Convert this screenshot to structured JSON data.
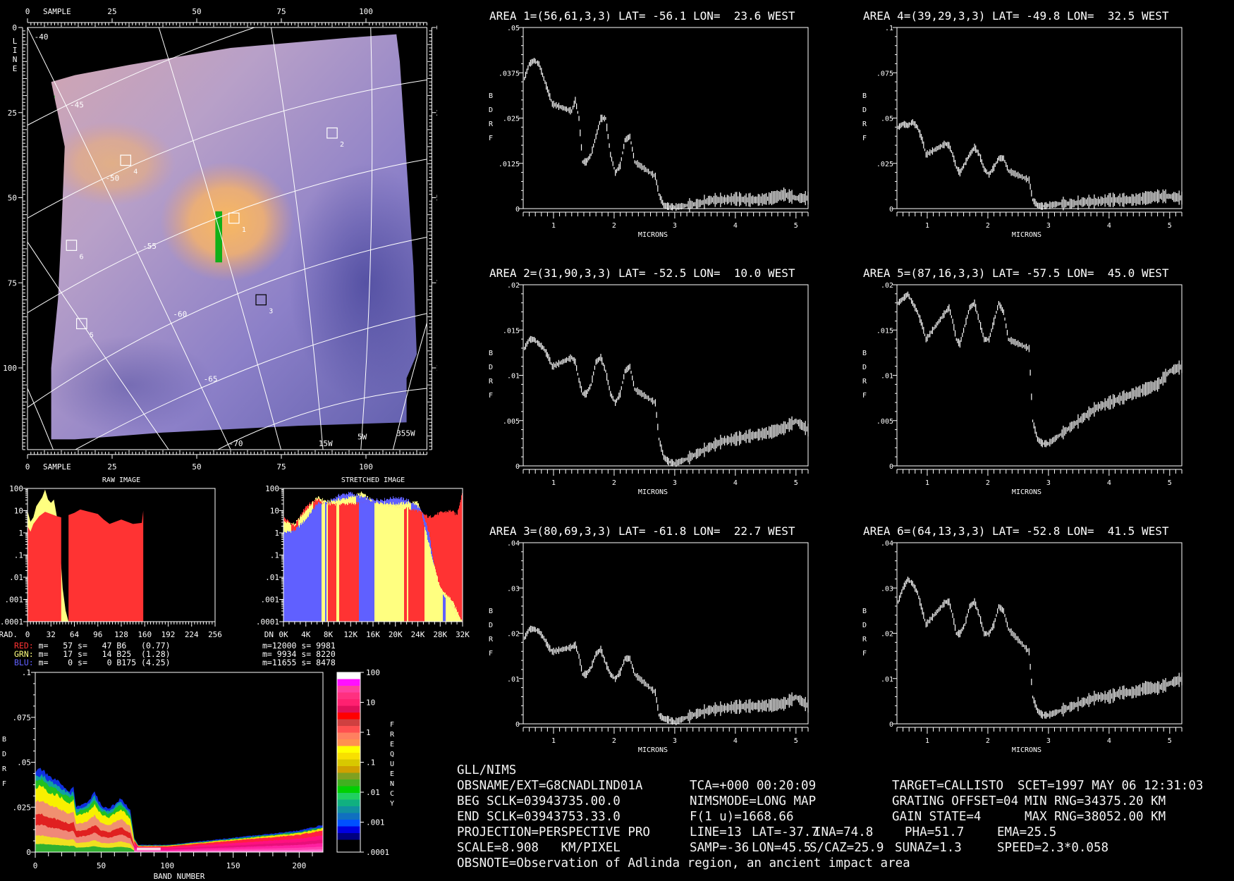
{
  "map": {
    "sample_label": "SAMPLE",
    "line_letters": [
      "L",
      "I",
      "N",
      "E"
    ],
    "axis_ticks": [
      "0",
      "25",
      "50",
      "75",
      "100"
    ],
    "lat_labels": [
      "-40",
      "-45",
      "-50",
      "-55",
      "-60",
      "-65",
      "-70"
    ],
    "lon_labels": [
      "15W",
      "5W",
      "355W"
    ]
  },
  "areas": [
    {
      "label": "1",
      "line": 56,
      "sample": 61,
      "title": "AREA 1=(56,61,3,3) LAT= -56.1 LON=  23.6 WEST",
      "ymax": 0.05,
      "yticks": [
        "0",
        ".0125",
        ".025",
        ".0375",
        ".05"
      ],
      "box_color": "#ffffff",
      "y": [
        0.036,
        0.04,
        0.041,
        0.04,
        0.036,
        0.032,
        0.029,
        0.027,
        0.03,
        0.025,
        0.013,
        0.013,
        0.015,
        0.02,
        0.025,
        0.025,
        0.015,
        0.01,
        0.012,
        0.019,
        0.02,
        0.013,
        0.009,
        0.004,
        0.001,
        0.0007,
        0.0005,
        0.001,
        0.0015,
        0.0025,
        0.0025,
        0.0028,
        0.0025,
        0.0025,
        0.003,
        0.004,
        0.003,
        0.003
      ]
    },
    {
      "label": "2",
      "line": 31,
      "sample": 90,
      "title": "AREA 2=(31,90,3,3) LAT= -52.5 LON=  10.0 WEST",
      "ymax": 0.02,
      "yticks": [
        "0",
        ".005",
        ".01",
        ".015",
        ".02"
      ],
      "box_color": "#ffffff",
      "y": [
        0.013,
        0.014,
        0.014,
        0.0135,
        0.013,
        0.012,
        0.011,
        0.012,
        0.0115,
        0.0095,
        0.008,
        0.008,
        0.009,
        0.0115,
        0.012,
        0.0105,
        0.008,
        0.007,
        0.008,
        0.0105,
        0.011,
        0.0085,
        0.007,
        0.003,
        0.001,
        0.0005,
        0.0003,
        0.0008,
        0.0015,
        0.0022,
        0.0028,
        0.003,
        0.0033,
        0.0035,
        0.0038,
        0.0042,
        0.005,
        0.004
      ]
    },
    {
      "label": "3",
      "line": 80,
      "sample": 69,
      "title": "AREA 3=(80,69,3,3) LAT= -61.8 LON=  22.7 WEST",
      "ymax": 0.04,
      "yticks": [
        "0",
        ".01",
        ".02",
        ".03",
        ".04"
      ],
      "box_color": "#000000",
      "y": [
        0.019,
        0.021,
        0.021,
        0.0205,
        0.019,
        0.017,
        0.016,
        0.017,
        0.0175,
        0.015,
        0.011,
        0.011,
        0.0125,
        0.0155,
        0.0165,
        0.0135,
        0.011,
        0.01,
        0.0115,
        0.0145,
        0.0145,
        0.011,
        0.007,
        0.002,
        0.0012,
        0.001,
        0.0005,
        0.0015,
        0.0025,
        0.0032,
        0.0035,
        0.0038,
        0.004,
        0.004,
        0.0042,
        0.0045,
        0.006,
        0.004
      ]
    },
    {
      "label": "4",
      "line": 39,
      "sample": 29,
      "title": "AREA 4=(39,29,3,3) LAT= -49.8 LON=  32.5 WEST",
      "ymax": 0.1,
      "yticks": [
        "0",
        ".025",
        ".05",
        ".075",
        ".1"
      ],
      "box_color": "#ffffff",
      "y": [
        0.045,
        0.047,
        0.046,
        0.048,
        0.045,
        0.038,
        0.03,
        0.036,
        0.035,
        0.03,
        0.023,
        0.02,
        0.025,
        0.03,
        0.034,
        0.03,
        0.022,
        0.019,
        0.023,
        0.028,
        0.028,
        0.021,
        0.016,
        0.005,
        0.002,
        0.0015,
        0.002,
        0.003,
        0.003,
        0.004,
        0.004,
        0.005,
        0.005,
        0.005,
        0.006,
        0.007,
        0.007,
        0.006
      ]
    },
    {
      "label": "5",
      "line": 87,
      "sample": 16,
      "title": "AREA 5=(87,16,3,3) LAT= -57.5 LON=  45.0 WEST",
      "ymax": 0.02,
      "yticks": [
        "0",
        ".005",
        ".01",
        ".015",
        ".02"
      ],
      "box_color": "#ffffff",
      "y": [
        0.018,
        0.0185,
        0.019,
        0.018,
        0.017,
        0.0155,
        0.014,
        0.017,
        0.0175,
        0.016,
        0.014,
        0.0135,
        0.0155,
        0.0175,
        0.018,
        0.016,
        0.014,
        0.014,
        0.016,
        0.018,
        0.017,
        0.014,
        0.013,
        0.005,
        0.003,
        0.0025,
        0.0025,
        0.0035,
        0.0045,
        0.0055,
        0.0065,
        0.007,
        0.0075,
        0.008,
        0.0085,
        0.009,
        0.0105,
        0.011
      ]
    },
    {
      "label": "6",
      "line": 64,
      "sample": 13,
      "title": "AREA 6=(64,13,3,3) LAT= -52.8 LON=  41.5 WEST",
      "ymax": 0.04,
      "yticks": [
        "0",
        ".01",
        ".02",
        ".03",
        ".04"
      ],
      "box_color": "#ffffff",
      "y": [
        0.027,
        0.03,
        0.032,
        0.031,
        0.029,
        0.025,
        0.022,
        0.027,
        0.027,
        0.024,
        0.02,
        0.02,
        0.022,
        0.026,
        0.027,
        0.024,
        0.02,
        0.02,
        0.022,
        0.026,
        0.025,
        0.021,
        0.016,
        0.006,
        0.003,
        0.002,
        0.002,
        0.003,
        0.004,
        0.005,
        0.006,
        0.006,
        0.007,
        0.007,
        0.008,
        0.008,
        0.009,
        0.01
      ]
    }
  ],
  "chart_data": [
    {
      "type": "scatter",
      "title": "Area spectra",
      "xlabel": "MICRONS",
      "ylabel": "BDRF",
      "ylabel_letters": [
        "B",
        "D",
        "R",
        "F"
      ],
      "xlim": [
        0.5,
        5.2
      ],
      "xticks": [
        "1",
        "2",
        "3",
        "4",
        "5"
      ],
      "x": [
        0.52,
        0.6,
        0.68,
        0.76,
        0.84,
        0.92,
        0.98,
        1.3,
        1.36,
        1.42,
        1.48,
        1.54,
        1.62,
        1.7,
        1.78,
        1.86,
        1.94,
        2.02,
        2.1,
        2.18,
        2.26,
        2.34,
        2.68,
        2.74,
        2.82,
        2.9,
        3.0,
        3.2,
        3.4,
        3.6,
        3.8,
        4.0,
        4.2,
        4.4,
        4.6,
        4.8,
        5.0,
        5.2
      ]
    },
    {
      "type": "area",
      "title": "RAW IMAGE",
      "xlabel": "RAD.",
      "xlim": [
        0,
        256
      ],
      "ylim_log10": [
        -4,
        2
      ],
      "xticks": [
        "0",
        "32",
        "64",
        "96",
        "128",
        "160",
        "192",
        "224",
        "256"
      ],
      "yticks": [
        "100",
        "10",
        "1",
        ".1",
        ".01",
        ".001",
        ".0001"
      ],
      "series": [
        {
          "name": "GRN",
          "color": "#ffff80",
          "points": [
            [
              0,
              1.0
            ],
            [
              4,
              0.5
            ],
            [
              8,
              0.7
            ],
            [
              12,
              1.2
            ],
            [
              16,
              1.4
            ],
            [
              20,
              1.6
            ],
            [
              24,
              1.95
            ],
            [
              28,
              1.5
            ],
            [
              32,
              1.35
            ],
            [
              36,
              1.5
            ],
            [
              40,
              0.75
            ],
            [
              44,
              -0.5
            ],
            [
              48,
              -2.5
            ],
            [
              52,
              -3.5
            ],
            [
              56,
              -4
            ]
          ]
        },
        {
          "name": "RED",
          "color": "#ff3333",
          "points": [
            [
              0,
              0.3
            ],
            [
              4,
              0.05
            ],
            [
              8,
              0.4
            ],
            [
              16,
              0.75
            ],
            [
              24,
              0.95
            ],
            [
              32,
              0.85
            ],
            [
              40,
              0.75
            ],
            [
              46,
              0.7
            ],
            [
              56,
              0.8
            ],
            [
              64,
              0.9
            ],
            [
              72,
              1.05
            ],
            [
              84,
              0.95
            ],
            [
              96,
              0.85
            ],
            [
              104,
              0.6
            ],
            [
              112,
              0.4
            ],
            [
              120,
              0.5
            ],
            [
              128,
              0.6
            ],
            [
              136,
              0.5
            ],
            [
              144,
              0.4
            ],
            [
              156,
              0.45
            ],
            [
              158,
              1.0
            ]
          ]
        }
      ],
      "legend": [
        {
          "name": "RED:",
          "color": "#ff3333",
          "text": "m=   57 s=   47 B6   (0.77)"
        },
        {
          "name": "GRN:",
          "color": "#ffff80",
          "text": "m=   17 s=   14 B25  (1.28)"
        },
        {
          "name": "BLU:",
          "color": "#6060ff",
          "text": "m=    0 s=    0 B175 (4.25)"
        }
      ]
    },
    {
      "type": "area",
      "title": "STRETCHED IMAGE",
      "xlabel": "DN",
      "xlim": [
        0,
        32
      ],
      "ylim_log10": [
        -4,
        2
      ],
      "xticks": [
        "0K",
        "4K",
        "8K",
        "12K",
        "16K",
        "20K",
        "24K",
        "28K",
        "32K"
      ],
      "yticks": [
        "100",
        "10",
        "1",
        ".1",
        ".01",
        ".001",
        ".0001"
      ],
      "series": [
        {
          "name": "BLU",
          "color": "#6060ff",
          "points": [
            [
              0,
              0
            ],
            [
              2,
              0.1
            ],
            [
              4,
              0.6
            ],
            [
              6,
              1.3
            ],
            [
              8,
              1.4
            ],
            [
              10,
              1.7
            ],
            [
              12,
              1.8
            ],
            [
              14,
              1.6
            ],
            [
              16,
              1.5
            ],
            [
              18,
              1.5
            ],
            [
              20,
              1.6
            ],
            [
              22,
              1.5
            ],
            [
              24,
              1.2
            ],
            [
              25,
              0.8
            ],
            [
              26,
              0
            ],
            [
              27,
              -1.5
            ],
            [
              28,
              -2.5
            ],
            [
              29,
              -3
            ],
            [
              30,
              -3.2
            ],
            [
              31,
              -3.8
            ],
            [
              32,
              -4
            ]
          ]
        },
        {
          "name": "RED",
          "color": "#ff3333",
          "points": [
            [
              0,
              0.7
            ],
            [
              2,
              0.3
            ],
            [
              4,
              1.2
            ],
            [
              6,
              1.5
            ],
            [
              8,
              1.3
            ],
            [
              12,
              1.3
            ],
            [
              16,
              1.4
            ],
            [
              20,
              1.2
            ],
            [
              24,
              1.0
            ],
            [
              26,
              0.7
            ],
            [
              28,
              0.9
            ],
            [
              30,
              1.0
            ],
            [
              31,
              0.8
            ],
            [
              32,
              1.9
            ]
          ]
        },
        {
          "name": "GRN",
          "color": "#ffff80",
          "points": [
            [
              0,
              0.5
            ],
            [
              2,
              0.4
            ],
            [
              4,
              1.0
            ],
            [
              6,
              1.6
            ],
            [
              8,
              1.4
            ],
            [
              12,
              1.6
            ],
            [
              14,
              1.8
            ],
            [
              16,
              1.4
            ],
            [
              20,
              1.3
            ],
            [
              24,
              1.4
            ],
            [
              25,
              0.5
            ],
            [
              26,
              -0.5
            ],
            [
              28,
              -2.5
            ],
            [
              30,
              -3
            ],
            [
              31,
              -3.5
            ],
            [
              32,
              -4
            ]
          ]
        }
      ],
      "bands": [
        [
          0,
          6.8,
          "BLU"
        ],
        [
          6.8,
          7.4,
          "GRN"
        ],
        [
          7.4,
          7.7,
          "BLU"
        ],
        [
          7.7,
          8.0,
          "GRN"
        ],
        [
          8.0,
          9.5,
          "RED"
        ],
        [
          9.5,
          10.0,
          "GRN"
        ],
        [
          10.0,
          13.5,
          "RED"
        ],
        [
          13.5,
          16.2,
          "BLU"
        ],
        [
          16.2,
          21.5,
          "GRN"
        ],
        [
          21.5,
          22.0,
          "RED"
        ],
        [
          22.0,
          22.3,
          "GRN"
        ],
        [
          22.3,
          25.2,
          "RED"
        ],
        [
          25.2,
          28.5,
          "GRN"
        ],
        [
          28.5,
          29.0,
          "BLU"
        ],
        [
          29.0,
          32,
          "GRN"
        ]
      ],
      "legend": [
        "m=12000 s= 9981",
        "m= 9934 s= 8220",
        "m=11655 s= 8478"
      ]
    },
    {
      "type": "heatmap",
      "title": "BDRF density",
      "xlabel": "BAND NUMBER",
      "ylabel_letters": [
        "B",
        "D",
        "R",
        "F"
      ],
      "xlim": [
        0,
        218
      ],
      "ylim": [
        0,
        0.1
      ],
      "xticks": [
        "0",
        "50",
        "100",
        "150",
        "200"
      ],
      "yticks": [
        "0",
        ".025",
        ".05",
        ".075",
        ".1"
      ],
      "envelope": [
        [
          0,
          0.045
        ],
        [
          5,
          0.046
        ],
        [
          10,
          0.042
        ],
        [
          18,
          0.039
        ],
        [
          26,
          0.034
        ],
        [
          29,
          0.036
        ],
        [
          31,
          0.025
        ],
        [
          40,
          0.028
        ],
        [
          45,
          0.033
        ],
        [
          50,
          0.026
        ],
        [
          56,
          0.024
        ],
        [
          65,
          0.03
        ],
        [
          72,
          0.023
        ],
        [
          75,
          0.008
        ],
        [
          78,
          0.004
        ],
        [
          100,
          0.004
        ],
        [
          150,
          0.008
        ],
        [
          175,
          0.01
        ],
        [
          200,
          0.012
        ],
        [
          218,
          0.015
        ]
      ],
      "colorbar": {
        "label_letters": [
          "F",
          "R",
          "E",
          "Q",
          "U",
          "E",
          "N",
          "C",
          "Y"
        ],
        "ticks": [
          "100",
          "10",
          "1",
          ".1",
          ".01",
          ".001",
          ".0001"
        ],
        "colors": [
          "#ffffff",
          "#ff10ff",
          "#ff40a0",
          "#ff3080",
          "#ff2070",
          "#e0105a",
          "#ff0000",
          "#d04040",
          "#ff5050",
          "#ff8060",
          "#ff9050",
          "#ffff00",
          "#f8e000",
          "#d8c800",
          "#d0a000",
          "#80a020",
          "#40b020",
          "#00d000",
          "#20d060",
          "#10b080",
          "#1090a0",
          "#1070c0",
          "#0050ff",
          "#0000e0",
          "#000080",
          "#000000"
        ]
      }
    }
  ],
  "info": {
    "header": "GLL/NIMS",
    "rows": [
      [
        "OBSNAME/EXT=G8CNADLIND01A",
        "TCA=+000 00:20:09",
        "TARGET=CALLISTO",
        "SCET=1997 MAY 06 12:31:03"
      ],
      [
        "BEG SCLK=03943735.00.0",
        "NIMSMODE=LONG MAP",
        "GRATING OFFSET=04",
        "MIN RNG=34375.20 KM"
      ],
      [
        "END SCLK=03943753.33.0",
        "F(1 u)=1668.66",
        "GAIN STATE=4",
        "MAX RNG=38052.00 KM"
      ],
      [
        "PROJECTION=PERSPECTIVE PRO",
        "LINE=13",
        "LAT=-37.7",
        "INA=74.8",
        "PHA=51.7",
        "EMA=25.5"
      ],
      [
        "SCALE=8.908   KM/PIXEL",
        "SAMP=-36",
        "LON=45.5",
        "S/CAZ=25.9",
        "SUNAZ=1.3",
        "SPEED=2.3*0.058"
      ],
      [
        "OBSNOTE=Observation of Adlinda region, an ancient impact area"
      ]
    ]
  }
}
